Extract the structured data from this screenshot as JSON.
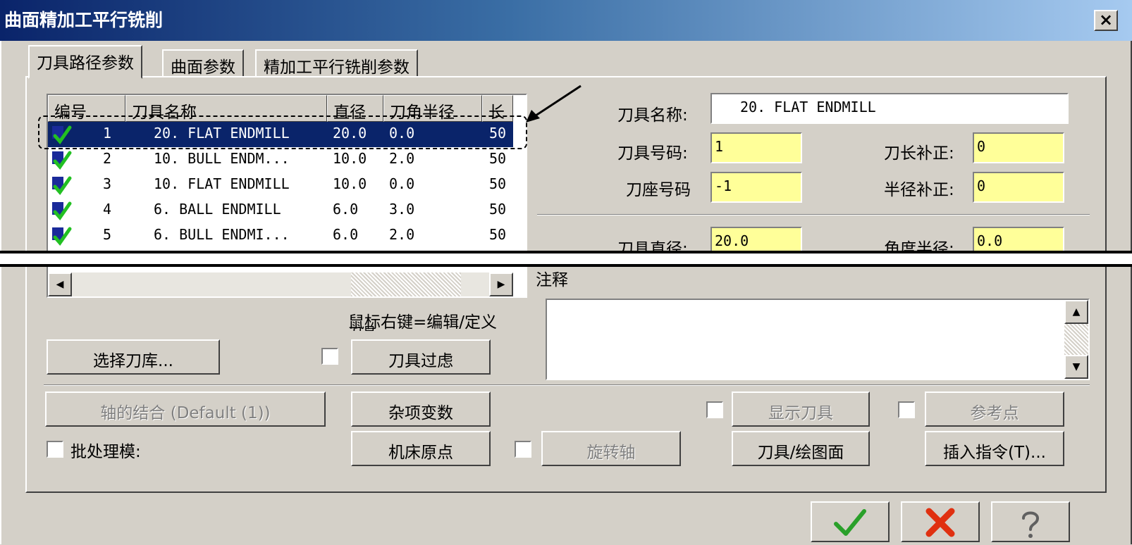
{
  "window": {
    "title": "曲面精加工平行铣削",
    "close_label": "×"
  },
  "tabs": [
    {
      "label": "刀具路径参数"
    },
    {
      "label": "曲面参数"
    },
    {
      "label": "精加工平行铣削参数"
    }
  ],
  "tool_list": {
    "headers": [
      "编号",
      "刀具名称",
      "直径",
      "刀角半径",
      "长"
    ],
    "rows": [
      {
        "num": "1",
        "name": "20. FLAT ENDMILL",
        "dia": "20.0",
        "rad": "0.0",
        "len": "50",
        "selected": true
      },
      {
        "num": "2",
        "name": "10. BULL ENDM...",
        "dia": "10.0",
        "rad": "2.0",
        "len": "50"
      },
      {
        "num": "3",
        "name": "10. FLAT ENDMILL",
        "dia": "10.0",
        "rad": "0.0",
        "len": "50"
      },
      {
        "num": "4",
        "name": "6. BALL ENDMILL",
        "dia": "6.0",
        "rad": "3.0",
        "len": "50"
      },
      {
        "num": "5",
        "name": "6. BULL ENDMI...",
        "dia": "6.0",
        "rad": "2.0",
        "len": "50"
      }
    ],
    "right_click_hint": "鼠标右键=编辑/定义",
    "hint_overflow": "刀具"
  },
  "tool_fields": {
    "name_label": "刀具名称:",
    "name_value": "20. FLAT ENDMILL",
    "number_label": "刀具号码:",
    "number_value": "1",
    "length_offset_label": "刀长补正:",
    "length_offset_value": "0",
    "holder_label": "刀座号码",
    "holder_value": "-1",
    "radius_offset_label": "半径补正:",
    "radius_offset_value": "0",
    "diameter_label": "刀具直径:",
    "diameter_value": "20.0",
    "corner_radius_label": "角度半径:",
    "corner_radius_value": "0.0",
    "comment_label": "注释"
  },
  "buttons": {
    "select_library": "选择刀库...",
    "tool_filter": "刀具过虑",
    "axis_combo": "轴的结合 (Default (1))",
    "misc_values": "杂项变数",
    "machine_origin": "机床原点",
    "rotary_axis": "旋转轴",
    "show_tool": "显示刀具",
    "ref_point": "参考点",
    "tool_plane": "刀具/绘图面",
    "insert_cmd": "插入指令(T)...",
    "batch_mode": "批处理模:"
  },
  "colors": {
    "selection": "#0a246a",
    "field_yellow": "#ffff99",
    "ok_green": "#2aa02a",
    "cancel_red": "#e03010"
  }
}
